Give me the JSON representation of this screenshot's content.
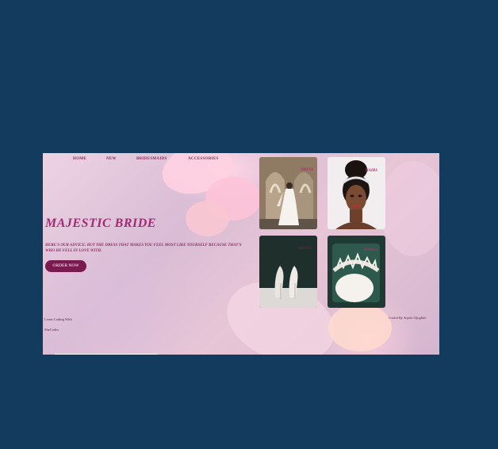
{
  "nav": {
    "home": "HOME",
    "new": "NEW",
    "bridesmaids": "BRIDESMAIDS",
    "accessories": "ACCESSORIES"
  },
  "hero": {
    "title": "MAJESTIC BRIDE",
    "advice": "HERE'S OUR ADVICE: BUY THE DRESS THAT MAKES YOU FEEL MOST LIKE YOURSELF BECAUSE THAT'S WHO HE FELL IN LOVE WITH.",
    "cta": "ORDER NOW"
  },
  "footer": {
    "left_line1": "Learn Coding With",
    "left_line2": "SheCodes",
    "right": "Coded By Anjola Ojogbile"
  },
  "gallery": [
    {
      "label": "DRESS"
    },
    {
      "label": "HAIRS"
    },
    {
      "label": "SHOES"
    },
    {
      "label": "TIARAS"
    }
  ],
  "colors": {
    "page_background": "#133b5e",
    "accent": "#a02a73",
    "button": "#7a1a4f"
  }
}
